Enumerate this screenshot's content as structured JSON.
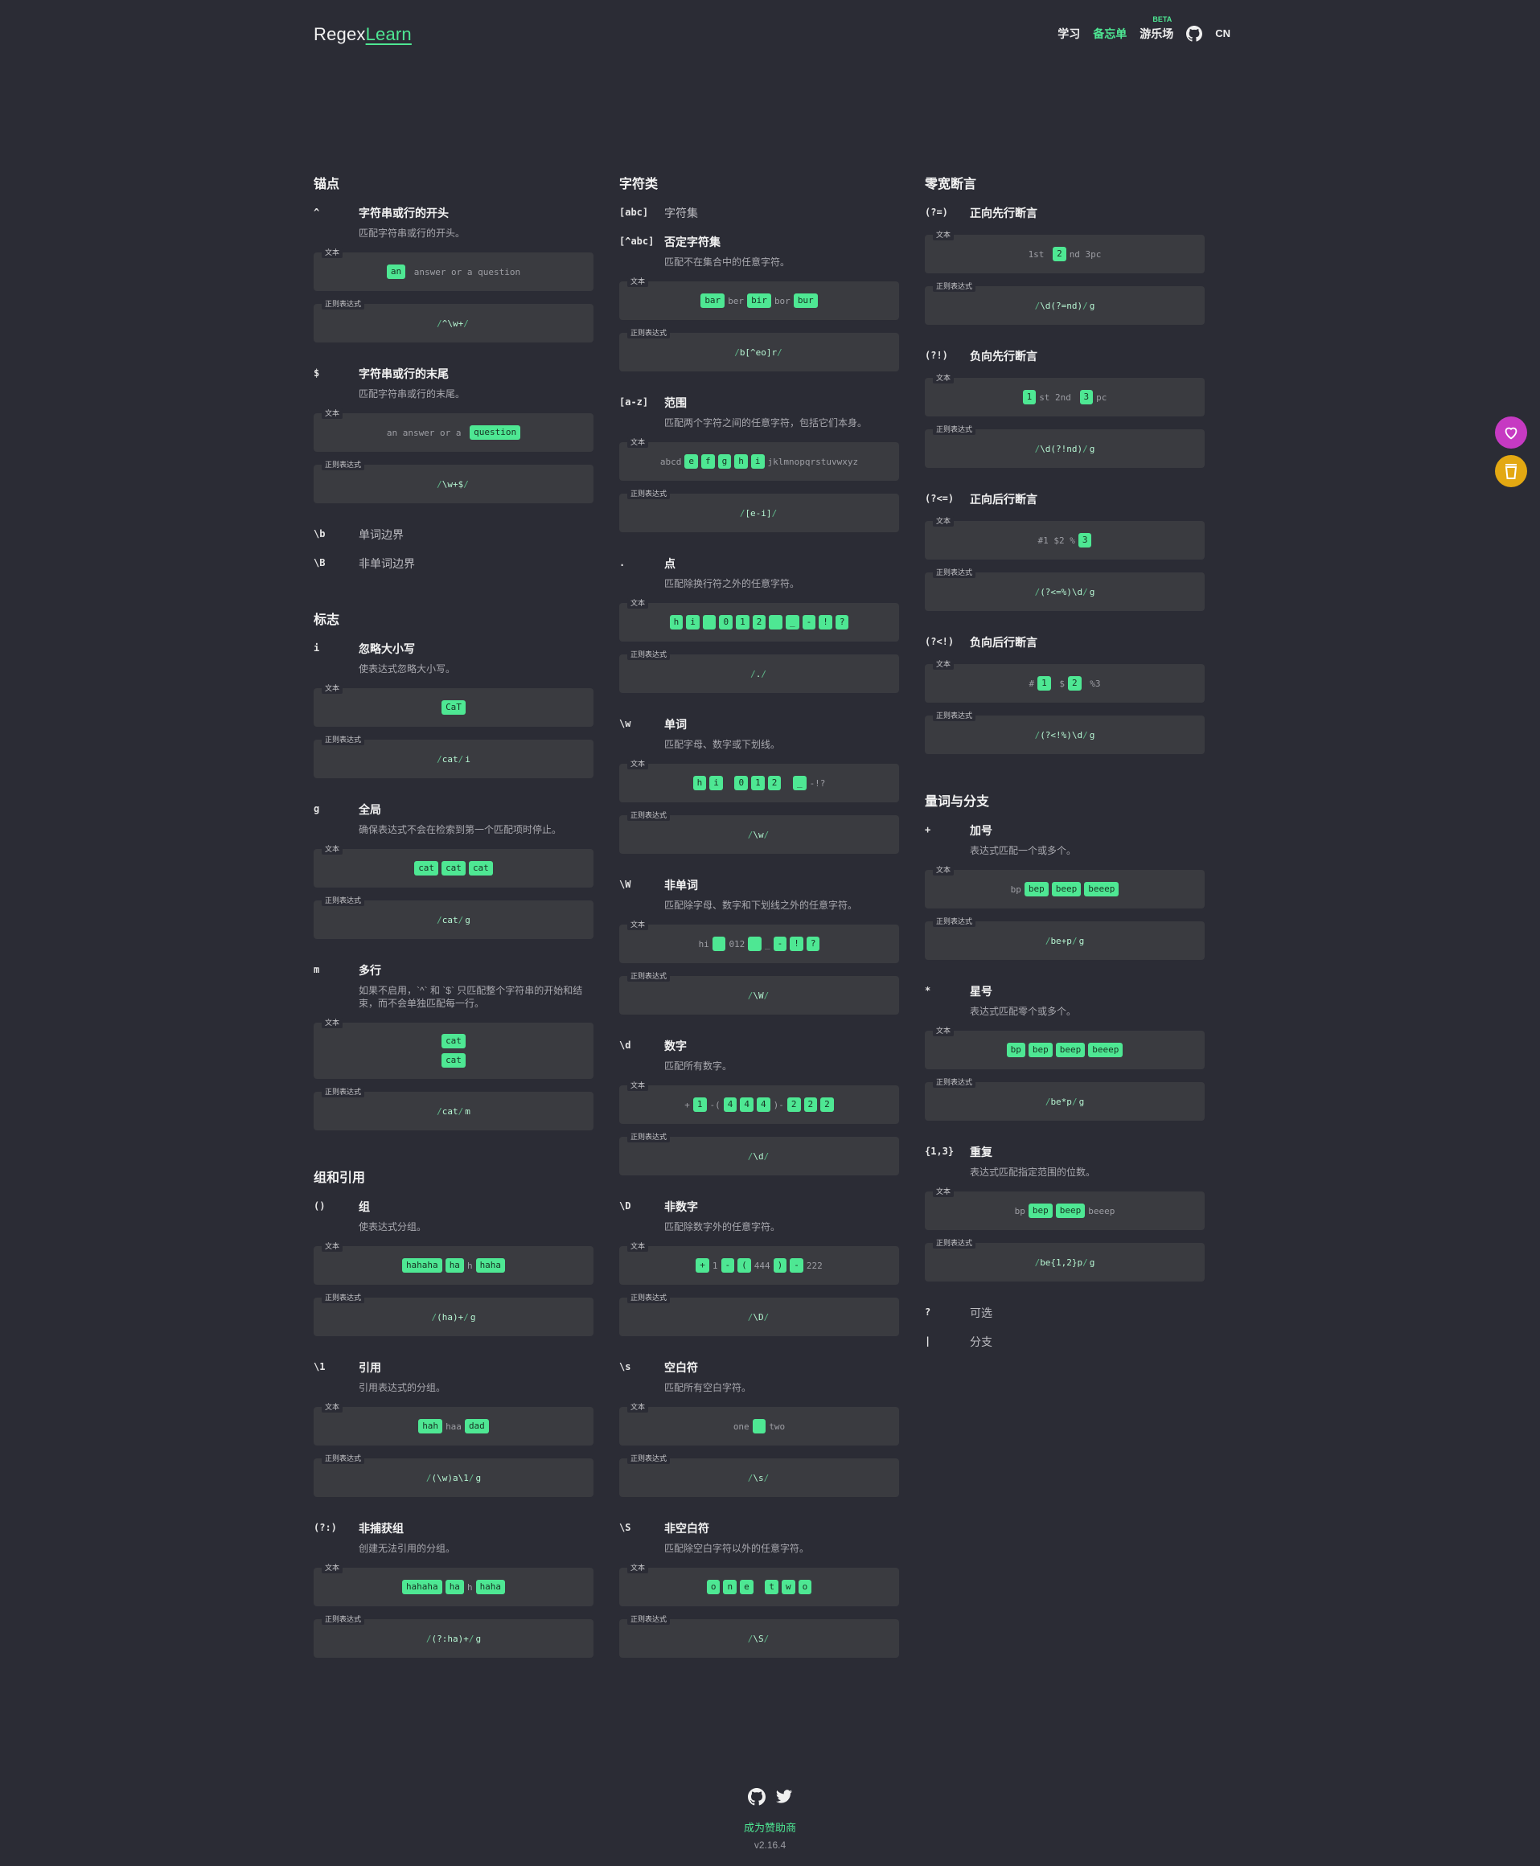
{
  "header": {
    "logo_a": "Regex",
    "logo_b": "Learn",
    "nav": {
      "learn": "学习",
      "cheatsheet": "备忘单",
      "playground": "游乐场",
      "beta": "BETA",
      "lang": "CN"
    }
  },
  "labels": {
    "text": "文本",
    "regex": "正则表达式"
  },
  "col1": {
    "anchors": {
      "title": "锚点",
      "caret": {
        "key": "^",
        "title": "字符串或行的开头",
        "desc": "匹配字符串或行的开头。",
        "regex": "^\\w+",
        "flags": ""
      },
      "dollar": {
        "key": "$",
        "title": "字符串或行的末尾",
        "desc": "匹配字符串或行的末尾。",
        "regex": "\\w+$",
        "flags": ""
      },
      "b": {
        "key": "\\b",
        "title": "单词边界"
      },
      "B": {
        "key": "\\B",
        "title": "非单词边界"
      }
    },
    "flags": {
      "title": "标志",
      "i": {
        "key": "i",
        "title": "忽略大小写",
        "desc": "使表达式忽略大小写。",
        "regex": "cat",
        "flags": "i"
      },
      "g": {
        "key": "g",
        "title": "全局",
        "desc": "确保表达式不会在检索到第一个匹配项时停止。",
        "regex": "cat",
        "flags": "g"
      },
      "m": {
        "key": "m",
        "title": "多行",
        "desc": "如果不启用，`^` 和 `$` 只匹配整个字符串的开始和结束，而不会单独匹配每一行。",
        "regex": "cat",
        "flags": "m"
      }
    },
    "groups": {
      "title": "组和引用",
      "group": {
        "key": "()",
        "title": "组",
        "desc": "使表达式分组。",
        "regex": "(ha)+",
        "flags": "g"
      },
      "ref": {
        "key": "\\1",
        "title": "引用",
        "desc": "引用表达式的分组。",
        "regex": "(\\w)a\\1",
        "flags": "g"
      },
      "noncap": {
        "key": "(?:)",
        "title": "非捕获组",
        "desc": "创建无法引用的分组。",
        "regex": "(?:ha)+",
        "flags": "g"
      }
    }
  },
  "col2": {
    "title": "字符类",
    "set": {
      "key": "[abc]",
      "title": "字符集"
    },
    "negset": {
      "key": "[^abc]",
      "title": "否定字符集",
      "desc": "匹配不在集合中的任意字符。",
      "regex": "b[^eo]r",
      "flags": ""
    },
    "range": {
      "key": "[a-z]",
      "title": "范围",
      "desc": "匹配两个字符之间的任意字符，包括它们本身。",
      "regex": "[e-i]",
      "flags": ""
    },
    "dot": {
      "key": ".",
      "title": "点",
      "desc": "匹配除换行符之外的任意字符。",
      "regex": ".",
      "flags": ""
    },
    "w": {
      "key": "\\w",
      "title": "单词",
      "desc": "匹配字母、数字或下划线。",
      "regex": "\\w",
      "flags": ""
    },
    "W": {
      "key": "\\W",
      "title": "非单词",
      "desc": "匹配除字母、数字和下划线之外的任意字符。",
      "regex": "\\W",
      "flags": ""
    },
    "d": {
      "key": "\\d",
      "title": "数字",
      "desc": "匹配所有数字。",
      "regex": "\\d",
      "flags": ""
    },
    "D": {
      "key": "\\D",
      "title": "非数字",
      "desc": "匹配除数字外的任意字符。",
      "regex": "\\D",
      "flags": ""
    },
    "s": {
      "key": "\\s",
      "title": "空白符",
      "desc": "匹配所有空白字符。",
      "regex": "\\s",
      "flags": ""
    },
    "S": {
      "key": "\\S",
      "title": "非空白符",
      "desc": "匹配除空白字符以外的任意字符。",
      "regex": "\\S",
      "flags": ""
    }
  },
  "col3": {
    "lookaround": {
      "title": "零宽断言",
      "pla": {
        "key": "(?=)",
        "title": "正向先行断言",
        "regex": "\\d(?=nd)",
        "flags": "g"
      },
      "nla": {
        "key": "(?!)",
        "title": "负向先行断言",
        "regex": "\\d(?!nd)",
        "flags": "g"
      },
      "plb": {
        "key": "(?<=)",
        "title": "正向后行断言",
        "regex": "(?<=%)\\d",
        "flags": "g"
      },
      "nlb": {
        "key": "(?<!)",
        "title": "负向后行断言",
        "regex": "(?<!%)\\d",
        "flags": "g"
      }
    },
    "quant": {
      "title": "量词与分支",
      "plus": {
        "key": "+",
        "title": "加号",
        "desc": "表达式匹配一个或多个。",
        "regex": "be+p",
        "flags": "g"
      },
      "star": {
        "key": "*",
        "title": "星号",
        "desc": "表达式匹配零个或多个。",
        "regex": "be*p",
        "flags": "g"
      },
      "rep": {
        "key": "{1,3}",
        "title": "重复",
        "desc": "表达式匹配指定范围的位数。",
        "regex": "be{1,2}p",
        "flags": "g"
      },
      "opt": {
        "key": "?",
        "title": "可选"
      },
      "alt": {
        "key": "|",
        "title": "分支"
      }
    }
  },
  "samples": {
    "caret": [
      [
        "an",
        true
      ],
      [
        " answer or a question",
        false
      ]
    ],
    "dollar": [
      [
        "an answer or a ",
        false
      ],
      [
        "question",
        true
      ]
    ],
    "i": [
      [
        "CaT",
        true
      ]
    ],
    "g": [
      [
        "cat",
        true
      ],
      [
        "cat",
        true
      ],
      [
        "cat",
        true
      ]
    ],
    "m1": [
      [
        "cat",
        true
      ]
    ],
    "m2": [
      [
        "cat",
        true
      ]
    ],
    "group": [
      [
        "hahaha",
        true
      ],
      [
        "ha",
        true
      ],
      [
        "h",
        false
      ],
      [
        "haha",
        true
      ]
    ],
    "ref": [
      [
        "hah",
        true
      ],
      [
        "haa",
        false
      ],
      [
        "dad",
        true
      ]
    ],
    "noncap": [
      [
        "hahaha",
        true
      ],
      [
        "ha",
        true
      ],
      [
        "h",
        false
      ],
      [
        "haha",
        true
      ]
    ],
    "negset": [
      [
        "bar",
        true
      ],
      [
        "ber",
        false
      ],
      [
        "bir",
        true
      ],
      [
        "bor",
        false
      ],
      [
        "bur",
        true
      ]
    ],
    "range": [
      [
        "abcd",
        false
      ],
      [
        "e",
        true
      ],
      [
        "f",
        true
      ],
      [
        "g",
        true
      ],
      [
        "h",
        true
      ],
      [
        "i",
        true
      ],
      [
        "jklmnopqrstuvwxyz",
        false
      ]
    ],
    "dot": [
      [
        "h",
        true
      ],
      [
        "i",
        true
      ],
      [
        " ",
        true
      ],
      [
        "0",
        true
      ],
      [
        "1",
        true
      ],
      [
        "2",
        true
      ],
      [
        " ",
        true
      ],
      [
        "_",
        true
      ],
      [
        "-",
        true
      ],
      [
        "!",
        true
      ],
      [
        "?",
        true
      ]
    ],
    "w": [
      [
        "h",
        true
      ],
      [
        "i",
        true
      ],
      [
        " ",
        false
      ],
      [
        "0",
        true
      ],
      [
        "1",
        true
      ],
      [
        "2",
        true
      ],
      [
        " ",
        false
      ],
      [
        "_",
        true
      ],
      [
        "-!?",
        false
      ]
    ],
    "W": [
      [
        "hi",
        false
      ],
      [
        " ",
        true
      ],
      [
        "012",
        false
      ],
      [
        " ",
        true
      ],
      [
        "_",
        false
      ],
      [
        "-",
        true
      ],
      [
        "!",
        true
      ],
      [
        "?",
        true
      ]
    ],
    "d": [
      [
        "+",
        false
      ],
      [
        "1",
        true
      ],
      [
        "-(",
        false
      ],
      [
        "4",
        true
      ],
      [
        "4",
        true
      ],
      [
        "4",
        true
      ],
      [
        ")-",
        false
      ],
      [
        "2",
        true
      ],
      [
        "2",
        true
      ],
      [
        "2",
        true
      ]
    ],
    "D": [
      [
        "+",
        true
      ],
      [
        "1",
        false
      ],
      [
        "-",
        true
      ],
      [
        "(",
        true
      ],
      [
        "444",
        false
      ],
      [
        ")",
        true
      ],
      [
        "-",
        true
      ],
      [
        "222",
        false
      ]
    ],
    "s": [
      [
        "one",
        false
      ],
      [
        " ",
        true
      ],
      [
        "two",
        false
      ]
    ],
    "S": [
      [
        "o",
        true
      ],
      [
        "n",
        true
      ],
      [
        "e",
        true
      ],
      [
        " ",
        false
      ],
      [
        "t",
        true
      ],
      [
        "w",
        true
      ],
      [
        "o",
        true
      ]
    ],
    "pla": [
      [
        "1st ",
        false
      ],
      [
        "2",
        true
      ],
      [
        "nd 3pc",
        false
      ]
    ],
    "nla": [
      [
        "1",
        true
      ],
      [
        "st 2nd ",
        false
      ],
      [
        "3",
        true
      ],
      [
        "pc",
        false
      ]
    ],
    "plb": [
      [
        "#1 $2 %",
        false
      ],
      [
        "3",
        true
      ]
    ],
    "nlb": [
      [
        "#",
        false
      ],
      [
        "1",
        true
      ],
      [
        " $",
        false
      ],
      [
        "2",
        true
      ],
      [
        " %3",
        false
      ]
    ],
    "plus": [
      [
        "bp",
        false
      ],
      [
        "bep",
        true
      ],
      [
        "beep",
        true
      ],
      [
        "beeep",
        true
      ]
    ],
    "star": [
      [
        "bp",
        true
      ],
      [
        "bep",
        true
      ],
      [
        "beep",
        true
      ],
      [
        "beeep",
        true
      ]
    ],
    "rep": [
      [
        "bp",
        false
      ],
      [
        "bep",
        true
      ],
      [
        "beep",
        true
      ],
      [
        "beeep",
        false
      ]
    ]
  },
  "footer": {
    "sponsor": "成为赞助商",
    "version": "v2.16.4"
  },
  "colors": {
    "accent": "#4ee793",
    "bg": "#2b2c35",
    "card": "#3a3b40"
  }
}
